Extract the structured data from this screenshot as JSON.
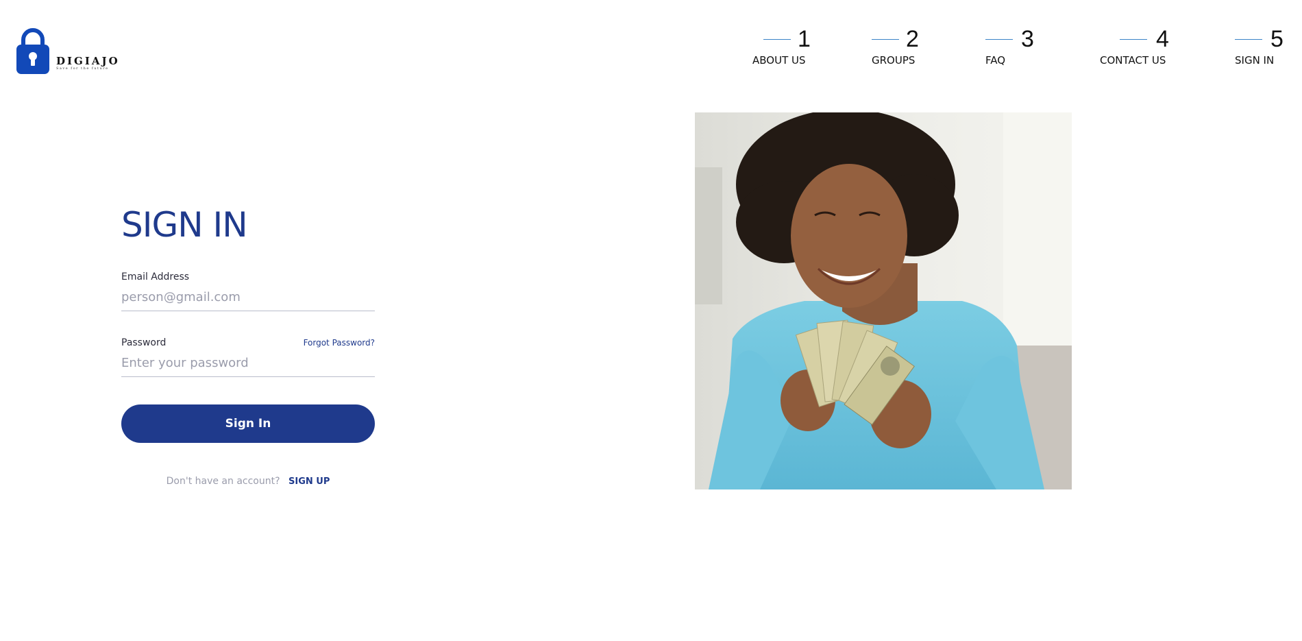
{
  "brand": {
    "name": "DIGIAJO",
    "tagline": "Save for the future",
    "logo_color": "#1249b8"
  },
  "nav": [
    {
      "number": "1",
      "label": "ABOUT US"
    },
    {
      "number": "2",
      "label": "GROUPS"
    },
    {
      "number": "3",
      "label": "FAQ"
    },
    {
      "number": "4",
      "label": "CONTACT US"
    },
    {
      "number": "5",
      "label": "SIGN IN"
    }
  ],
  "signin": {
    "title": "SIGN IN",
    "email_label": "Email Address",
    "email_placeholder": "person@gmail.com",
    "email_value": "",
    "password_label": "Password",
    "password_placeholder": "Enter your password",
    "password_value": "",
    "forgot_label": "Forgot Password?",
    "button_label": "Sign In",
    "signup_prompt": "Don't have an account?",
    "signup_label": "SIGN UP"
  },
  "hero": {
    "image_subject": "woman in blue shirt counting dollar bills"
  },
  "colors": {
    "primary": "#1f3a8c",
    "nav_line": "#3b83c8",
    "muted_text": "#9a9cab",
    "input_border": "#b9bccb"
  }
}
